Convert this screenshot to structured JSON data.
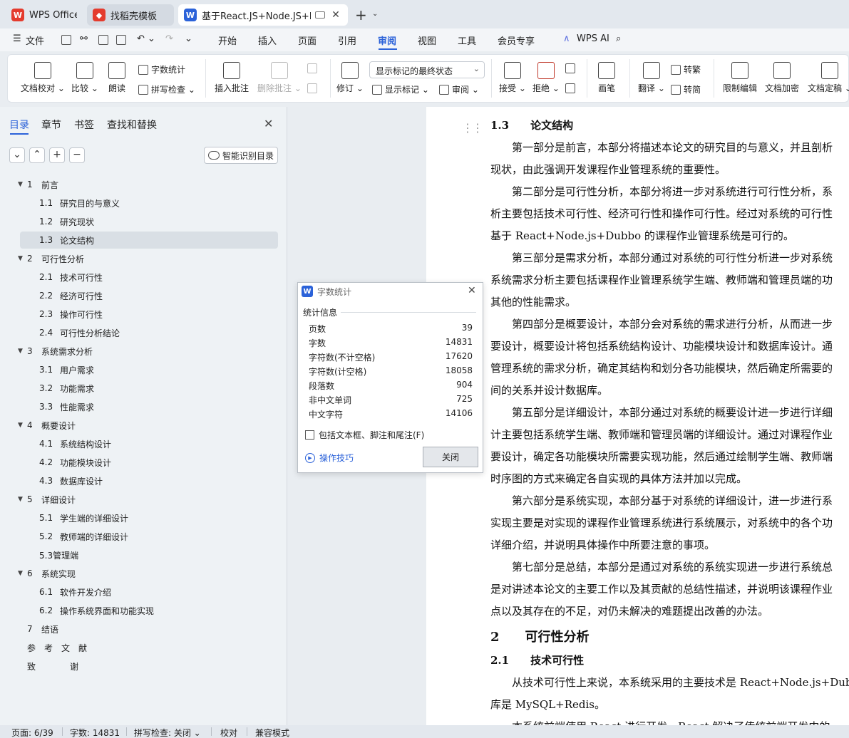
{
  "tabs": [
    {
      "label": "WPS Office",
      "icon": "wps-logo-icon",
      "color": "#e43b2d"
    },
    {
      "label": "找稻壳模板",
      "icon": "docer-icon",
      "color": "#e43b2d"
    },
    {
      "label": "基于React.JS+Node.JS+Dub",
      "icon": "wps-writer-icon",
      "color": "#2b62d9"
    }
  ],
  "menu": {
    "file": "文件",
    "items": [
      "开始",
      "插入",
      "页面",
      "引用",
      "审阅",
      "视图",
      "工具",
      "会员专享"
    ],
    "active": "审阅",
    "ai": "WPS AI"
  },
  "ribbon": {
    "proofread": "文档校对",
    "compare": "比较",
    "read_aloud": "朗读",
    "word_count": "字数统计",
    "spell_check": "拼写检查",
    "insert_comment": "插入批注",
    "delete_comment": "删除批注",
    "revise": "修订",
    "markup_state": "显示标记的最终状态",
    "show_markup": "显示标记",
    "review": "审阅",
    "accept": "接受",
    "reject": "拒绝",
    "pen": "画笔",
    "translate": "翻译",
    "to_traditional": "转繁",
    "to_simplified": "转简",
    "restrict_edit": "限制编辑",
    "encrypt": "文档加密",
    "finalize": "文档定稿"
  },
  "nav": {
    "tabs": [
      "目录",
      "章节",
      "书签",
      "查找和替换"
    ],
    "smart_toc": "智能识别目录",
    "toc": [
      {
        "num": "1",
        "text": "前言",
        "level": 1,
        "expanded": true
      },
      {
        "num": "1.1",
        "text": "研究目的与意义",
        "level": 2
      },
      {
        "num": "1.2",
        "text": "研究现状",
        "level": 2
      },
      {
        "num": "1.3",
        "text": "论文结构",
        "level": 2,
        "selected": true
      },
      {
        "num": "2",
        "text": "可行性分析",
        "level": 1,
        "expanded": true
      },
      {
        "num": "2.1",
        "text": "技术可行性",
        "level": 2
      },
      {
        "num": "2.2",
        "text": "经济可行性",
        "level": 2
      },
      {
        "num": "2.3",
        "text": "操作可行性",
        "level": 2
      },
      {
        "num": "2.4",
        "text": "可行性分析结论",
        "level": 2
      },
      {
        "num": "3",
        "text": "系统需求分析",
        "level": 1,
        "expanded": true
      },
      {
        "num": "3.1",
        "text": "用户需求",
        "level": 2
      },
      {
        "num": "3.2",
        "text": "功能需求",
        "level": 2
      },
      {
        "num": "3.3",
        "text": "性能需求",
        "level": 2
      },
      {
        "num": "4",
        "text": "概要设计",
        "level": 1,
        "expanded": true
      },
      {
        "num": "4.1",
        "text": "系统结构设计",
        "level": 2
      },
      {
        "num": "4.2",
        "text": "功能模块设计",
        "level": 2
      },
      {
        "num": "4.3",
        "text": "数据库设计",
        "level": 2
      },
      {
        "num": "5",
        "text": "详细设计",
        "level": 1,
        "expanded": true
      },
      {
        "num": "5.1",
        "text": "学生端的详细设计",
        "level": 2
      },
      {
        "num": "5.2",
        "text": "教师端的详细设计",
        "level": 2
      },
      {
        "num": "",
        "text": "5.3管理端",
        "level": 2
      },
      {
        "num": "6",
        "text": "系统实现",
        "level": 1,
        "expanded": true
      },
      {
        "num": "6.1",
        "text": "软件开发介绍",
        "level": 2
      },
      {
        "num": "6.2",
        "text": "操作系统界面和功能实现",
        "level": 2
      },
      {
        "num": "7",
        "text": "结语",
        "level": 1
      },
      {
        "num": "",
        "text": "参　考　文　献",
        "level": 0
      },
      {
        "num": "",
        "text": "致　　　　谢",
        "level": 0
      }
    ]
  },
  "document": {
    "lines": [
      {
        "kind": "h2",
        "text": "1.3　　论文结构"
      },
      {
        "kind": "p",
        "text": "　　第一部分是前言，本部分将描述本论文的研究目的与意义，并且剖析"
      },
      {
        "kind": "p",
        "text": "现状，由此强调开发课程作业管理系统的重要性。"
      },
      {
        "kind": "p",
        "text": "　　第二部分是可行性分析，本部分将进一步对系统进行可行性分析，系"
      },
      {
        "kind": "p",
        "text": "析主要包括技术可行性、经济可行性和操作可行性。经过对系统的可行性"
      },
      {
        "kind": "p",
        "text": "基于 React+Node.js+Dubbo 的课程作业管理系统是可行的。"
      },
      {
        "kind": "p",
        "text": "　　第三部分是需求分析，本部分通过对系统的可行性分析进一步对系统"
      },
      {
        "kind": "p",
        "text": "系统需求分析主要包括课程作业管理系统学生端、教师端和管理员端的功"
      },
      {
        "kind": "p",
        "text": "其他的性能需求。"
      },
      {
        "kind": "p",
        "text": "　　第四部分是概要设计，本部分会对系统的需求进行分析，从而进一步"
      },
      {
        "kind": "p",
        "text": "要设计，概要设计将包括系统结构设计、功能模块设计和数据库设计。通"
      },
      {
        "kind": "p",
        "text": "管理系统的需求分析，确定其结构和划分各功能模块，然后确定所需要的"
      },
      {
        "kind": "p",
        "text": "间的关系并设计数据库。"
      },
      {
        "kind": "p",
        "text": "　　第五部分是详细设计，本部分通过对系统的概要设计进一步进行详细"
      },
      {
        "kind": "p",
        "text": "计主要包括系统学生端、教师端和管理员端的详细设计。通过对课程作业"
      },
      {
        "kind": "p",
        "text": "要设计，确定各功能模块所需要实现功能，然后通过绘制学生端、教师端"
      },
      {
        "kind": "p",
        "text": "时序图的方式来确定各自实现的具体方法并加以完成。"
      },
      {
        "kind": "p",
        "text": "　　第六部分是系统实现，本部分基于对系统的详细设计，进一步进行系"
      },
      {
        "kind": "p",
        "text": "实现主要是对实现的课程作业管理系统进行系统展示，对系统中的各个功"
      },
      {
        "kind": "p",
        "text": "详细介绍，并说明具体操作中所要注意的事项。"
      },
      {
        "kind": "p",
        "text": "　　第七部分是总结，本部分是通过对系统的系统实现进一步进行系统总"
      },
      {
        "kind": "p",
        "text": "是对讲述本论文的主要工作以及其贡献的总结性描述，并说明该课程作业"
      },
      {
        "kind": "p",
        "text": "点以及其存在的不足，对仍未解决的难题提出改善的办法。"
      },
      {
        "kind": "h1",
        "text": "2　　可行性分析"
      },
      {
        "kind": "h2",
        "text": "2.1　　技术可行性"
      },
      {
        "kind": "p",
        "text": "　　从技术可行性上来说，本系统采用的主要技术是 React+Node.js+Dubbo"
      },
      {
        "kind": "p",
        "text": "库是 MySQL+Redis。"
      },
      {
        "kind": "p",
        "text": "　　本系统前端使用 React 进行开发，React 解决了传统前端开发中的"
      }
    ]
  },
  "dialog": {
    "title": "字数统计",
    "group": "统计信息",
    "stats": [
      {
        "label": "页数",
        "value": "39"
      },
      {
        "label": "字数",
        "value": "14831"
      },
      {
        "label": "字符数(不计空格)",
        "value": "17620"
      },
      {
        "label": "字符数(计空格)",
        "value": "18058"
      },
      {
        "label": "段落数",
        "value": "904"
      },
      {
        "label": "非中文单词",
        "value": "725"
      },
      {
        "label": "中文字符",
        "value": "14106"
      }
    ],
    "checkbox_label": "包括文本框、脚注和尾注(F)",
    "checkbox_checked": false,
    "tips": "操作技巧",
    "close": "关闭"
  },
  "status": {
    "page": "页面: 6/39",
    "words": "字数: 14831",
    "spell": "拼写检查: 关闭",
    "proof": "校对",
    "compat": "兼容模式"
  }
}
